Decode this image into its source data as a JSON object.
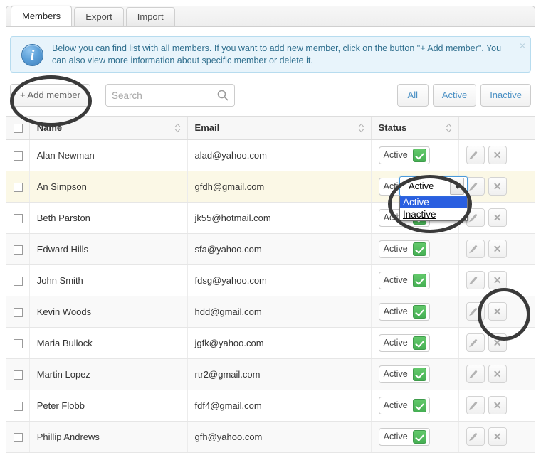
{
  "tabs": [
    {
      "label": "Members",
      "active": true
    },
    {
      "label": "Export",
      "active": false
    },
    {
      "label": "Import",
      "active": false
    }
  ],
  "alert": {
    "icon": "info-icon",
    "text": "Below you can find list with all members. If you want to add new member, click on the button \"+ Add member\". You can also view more information about specific member or delete it.",
    "close_label": "×"
  },
  "toolbar": {
    "add_label": "+ Add member",
    "search_placeholder": "Search",
    "search_value": "",
    "filters": [
      {
        "label": "All"
      },
      {
        "label": "Active"
      },
      {
        "label": "Inactive"
      }
    ]
  },
  "table": {
    "columns": [
      {
        "key": "check",
        "label": ""
      },
      {
        "key": "name",
        "label": "Name",
        "sortable": true
      },
      {
        "key": "email",
        "label": "Email",
        "sortable": true
      },
      {
        "key": "status",
        "label": "Status",
        "sortable": true
      },
      {
        "key": "actions",
        "label": ""
      }
    ],
    "rows": [
      {
        "name": "Alan Newman",
        "email": "alad@yahoo.com",
        "status": "Active",
        "highlight": false
      },
      {
        "name": "An Simpson",
        "email": "gfdh@gmail.com",
        "status": "Active",
        "highlight": true
      },
      {
        "name": "Beth Parston",
        "email": "jk55@hotmail.com",
        "status": "Active",
        "highlight": false
      },
      {
        "name": "Edward Hills",
        "email": "sfa@yahoo.com",
        "status": "Active",
        "highlight": false
      },
      {
        "name": "John Smith",
        "email": "fdsg@yahoo.com",
        "status": "Active",
        "highlight": false
      },
      {
        "name": "Kevin Woods",
        "email": "hdd@gmail.com",
        "status": "Active",
        "highlight": false
      },
      {
        "name": "Maria Bullock",
        "email": "jgfk@yahoo.com",
        "status": "Active",
        "highlight": false
      },
      {
        "name": "Martin Lopez",
        "email": "rtr2@gmail.com",
        "status": "Active",
        "highlight": false
      },
      {
        "name": "Peter Flobb",
        "email": "fdf4@gmail.com",
        "status": "Active",
        "highlight": false
      },
      {
        "name": "Phillip Andrews",
        "email": "gfh@yahoo.com",
        "status": "Active",
        "highlight": false
      }
    ],
    "row_actions": {
      "edit_icon": "pencil-icon",
      "delete_icon": "x-icon"
    }
  },
  "status_select": {
    "value": "Active",
    "open": true,
    "options": [
      {
        "label": "Active",
        "selected": true
      },
      {
        "label": "Inactive",
        "selected": false
      }
    ]
  },
  "annotations": [
    {
      "name": "add-member-highlight"
    },
    {
      "name": "status-select-highlight"
    },
    {
      "name": "row-actions-highlight"
    }
  ],
  "colors": {
    "accent_blue": "#4a90c4",
    "alert_bg": "#e8f4fb",
    "alert_border": "#b7dcef",
    "alert_text": "#31708f",
    "status_green": "#46b054",
    "select_highlight": "#2a5fe0",
    "row_highlight": "#fbf8e6",
    "annotation": "#3a3a3a"
  }
}
